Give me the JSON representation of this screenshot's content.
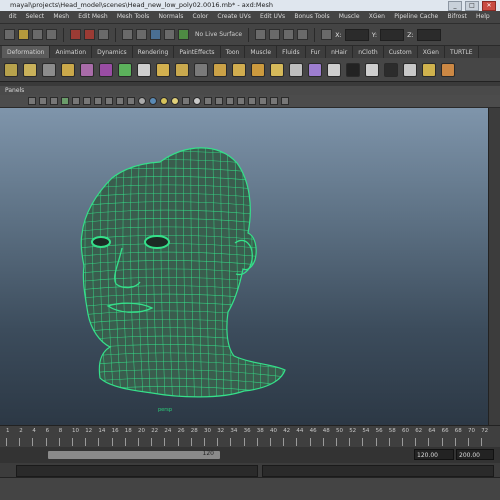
{
  "window": {
    "title": "mayal\\projects\\Head_model\\scenes\\Head_new_low_poly02.0016.mb* - axd:Mesh"
  },
  "menubar": {
    "items": [
      "dit",
      "Select",
      "Mesh",
      "Edit Mesh",
      "Mesh Tools",
      "Normals",
      "Color",
      "Create UVs",
      "Edit UVs",
      "Bonus Tools",
      "Muscle",
      "XGen",
      "Pipeline Cache",
      "Bifrost",
      "Help"
    ]
  },
  "statusline": {
    "live_surface": "No Live Surface",
    "x_label": "X:",
    "y_label": "Y:",
    "z_label": "Z:"
  },
  "shelf_tabs": {
    "items": [
      "Deformation",
      "Animation",
      "Dynamics",
      "Rendering",
      "PaintEffects",
      "Toon",
      "Muscle",
      "Fluids",
      "Fur",
      "nHair",
      "nCloth",
      "Custom",
      "XGen",
      "TURTLE"
    ],
    "selected_index": 0
  },
  "shelf": {
    "colors": [
      "#b7a24c",
      "#c9b15a",
      "#8c8c8c",
      "#caa84a",
      "#a96ca9",
      "#9a4da4",
      "#5cb25c",
      "#cfcfcf",
      "#d2b04f",
      "#c9a94e",
      "#7a7a7a",
      "#cba247",
      "#d1ad4f",
      "#cc9a3e",
      "#d5b95a",
      "#bfbfbf",
      "#9e7ed0",
      "#cfcfcf",
      "#222222",
      "#cfcfcf",
      "#2c2c2c",
      "#c8c8c8",
      "#d0b24d",
      "#cc8844"
    ]
  },
  "panel": {
    "label": "Panels"
  },
  "model": {
    "wire_color": "#35e08a",
    "fill_color": "#3a5d4e",
    "label": "persp"
  },
  "timeslider": {
    "ticks": [
      "1",
      "2",
      "4",
      "6",
      "8",
      "10",
      "12",
      "14",
      "16",
      "18",
      "20",
      "22",
      "24",
      "26",
      "28",
      "30",
      "32",
      "34",
      "36",
      "38",
      "40",
      "42",
      "44",
      "46",
      "48",
      "50",
      "52",
      "54",
      "56",
      "58",
      "60",
      "62",
      "64",
      "66",
      "68",
      "70",
      "72"
    ]
  },
  "range": {
    "start": "120",
    "end": "120.00",
    "max": "200.00"
  }
}
